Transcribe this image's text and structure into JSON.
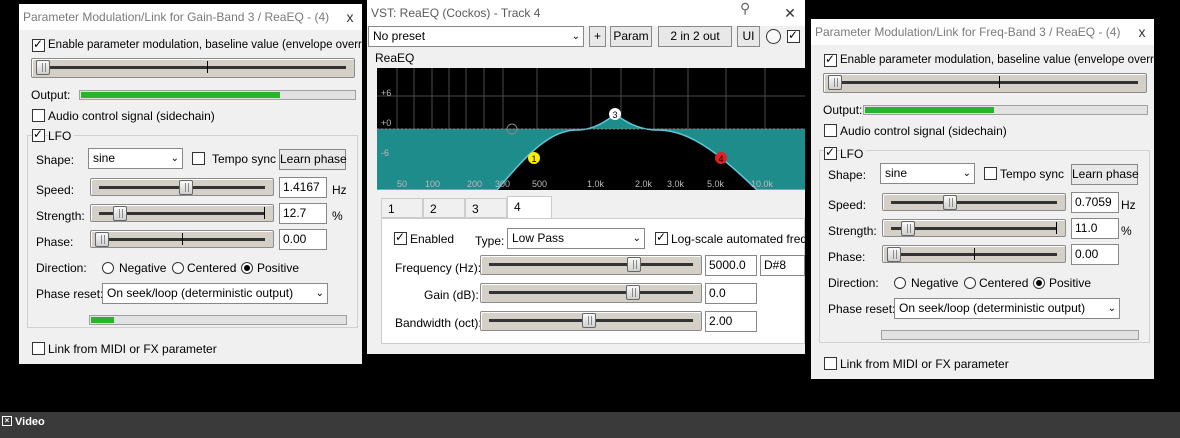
{
  "left_window": {
    "title": "Parameter Modulation/Link for Gain-Band 3 / ReaEQ - (4)",
    "close_label": "x",
    "enable_mod_label": "Enable parameter modulation, baseline value (envelope overrides):",
    "output_label": "Output:",
    "output_level": 0.73,
    "audio_control_label": "Audio control signal (sidechain)",
    "lfo_label": "LFO",
    "shape_label": "Shape:",
    "shape_value": "sine",
    "tempo_sync_label": "Tempo sync",
    "learn_phase_label": "Learn phase",
    "speed_label": "Speed:",
    "speed_value": "1.4167",
    "speed_unit": "Hz",
    "strength_label": "Strength:",
    "strength_value": "12.7",
    "strength_unit": "%",
    "phase_label": "Phase:",
    "phase_value": "0.00",
    "direction_label": "Direction:",
    "dir_negative": "Negative",
    "dir_centered": "Centered",
    "dir_positive": "Positive",
    "phase_reset_label": "Phase reset:",
    "phase_reset_value": "On seek/loop (deterministic output)",
    "lfo_level": 0.09,
    "link_label": "Link from MIDI or FX parameter"
  },
  "center_window": {
    "title": "VST: ReaEQ (Cockos) - Track 4",
    "preset_value": "No preset",
    "plus_label": "+",
    "param_label": "Param",
    "io_label": "2 in 2 out",
    "ui_label": "UI",
    "plugin_label": "ReaEQ",
    "db_labels": [
      "+6",
      "+0",
      "-6"
    ],
    "freq_labels": [
      "50",
      "100",
      "200",
      "300",
      "500",
      "1.0k",
      "2.0k",
      "3.0k",
      "5.0k",
      "10.0k"
    ],
    "nodes": [
      "1",
      "3",
      "4"
    ],
    "tabs": [
      "1",
      "2",
      "3",
      "4"
    ],
    "enabled_label": "Enabled",
    "type_label": "Type:",
    "type_value": "Low Pass",
    "logscale_label": "Log-scale automated frequer",
    "frequency_label": "Frequency (Hz):",
    "frequency_value": "5000.0",
    "note_value": "D#8",
    "gain_label": "Gain (dB):",
    "gain_value": "0.0",
    "bandwidth_label": "Bandwidth (oct):",
    "bandwidth_value": "2.00"
  },
  "right_window": {
    "title": "Parameter Modulation/Link for Freq-Band 3 / ReaEQ - (4)",
    "close_label": "x",
    "enable_mod_label": "Enable parameter modulation, baseline value (envelope overrides):",
    "output_label": "Output:",
    "output_level": 0.46,
    "audio_control_label": "Audio control signal (sidechain)",
    "lfo_label": "LFO",
    "shape_label": "Shape:",
    "shape_value": "sine",
    "tempo_sync_label": "Tempo sync",
    "learn_phase_label": "Learn phase",
    "speed_label": "Speed:",
    "speed_value": "0.7059",
    "speed_unit": "Hz",
    "strength_label": "Strength:",
    "strength_value": "11.0",
    "strength_unit": "%",
    "phase_label": "Phase:",
    "phase_value": "0.00",
    "direction_label": "Direction:",
    "dir_negative": "Negative",
    "dir_centered": "Centered",
    "dir_positive": "Positive",
    "phase_reset_label": "Phase reset:",
    "phase_reset_value": "On seek/loop (deterministic output)",
    "lfo_level": 0.0,
    "link_label": "Link from MIDI or FX parameter"
  },
  "taskbar": {
    "label": "Video"
  },
  "colors": {
    "eq_fill": "#1f8c8c",
    "curve": "#5ec8d8",
    "node1": "#ffee00",
    "node4": "#e02020",
    "meter": "#27b32a"
  }
}
